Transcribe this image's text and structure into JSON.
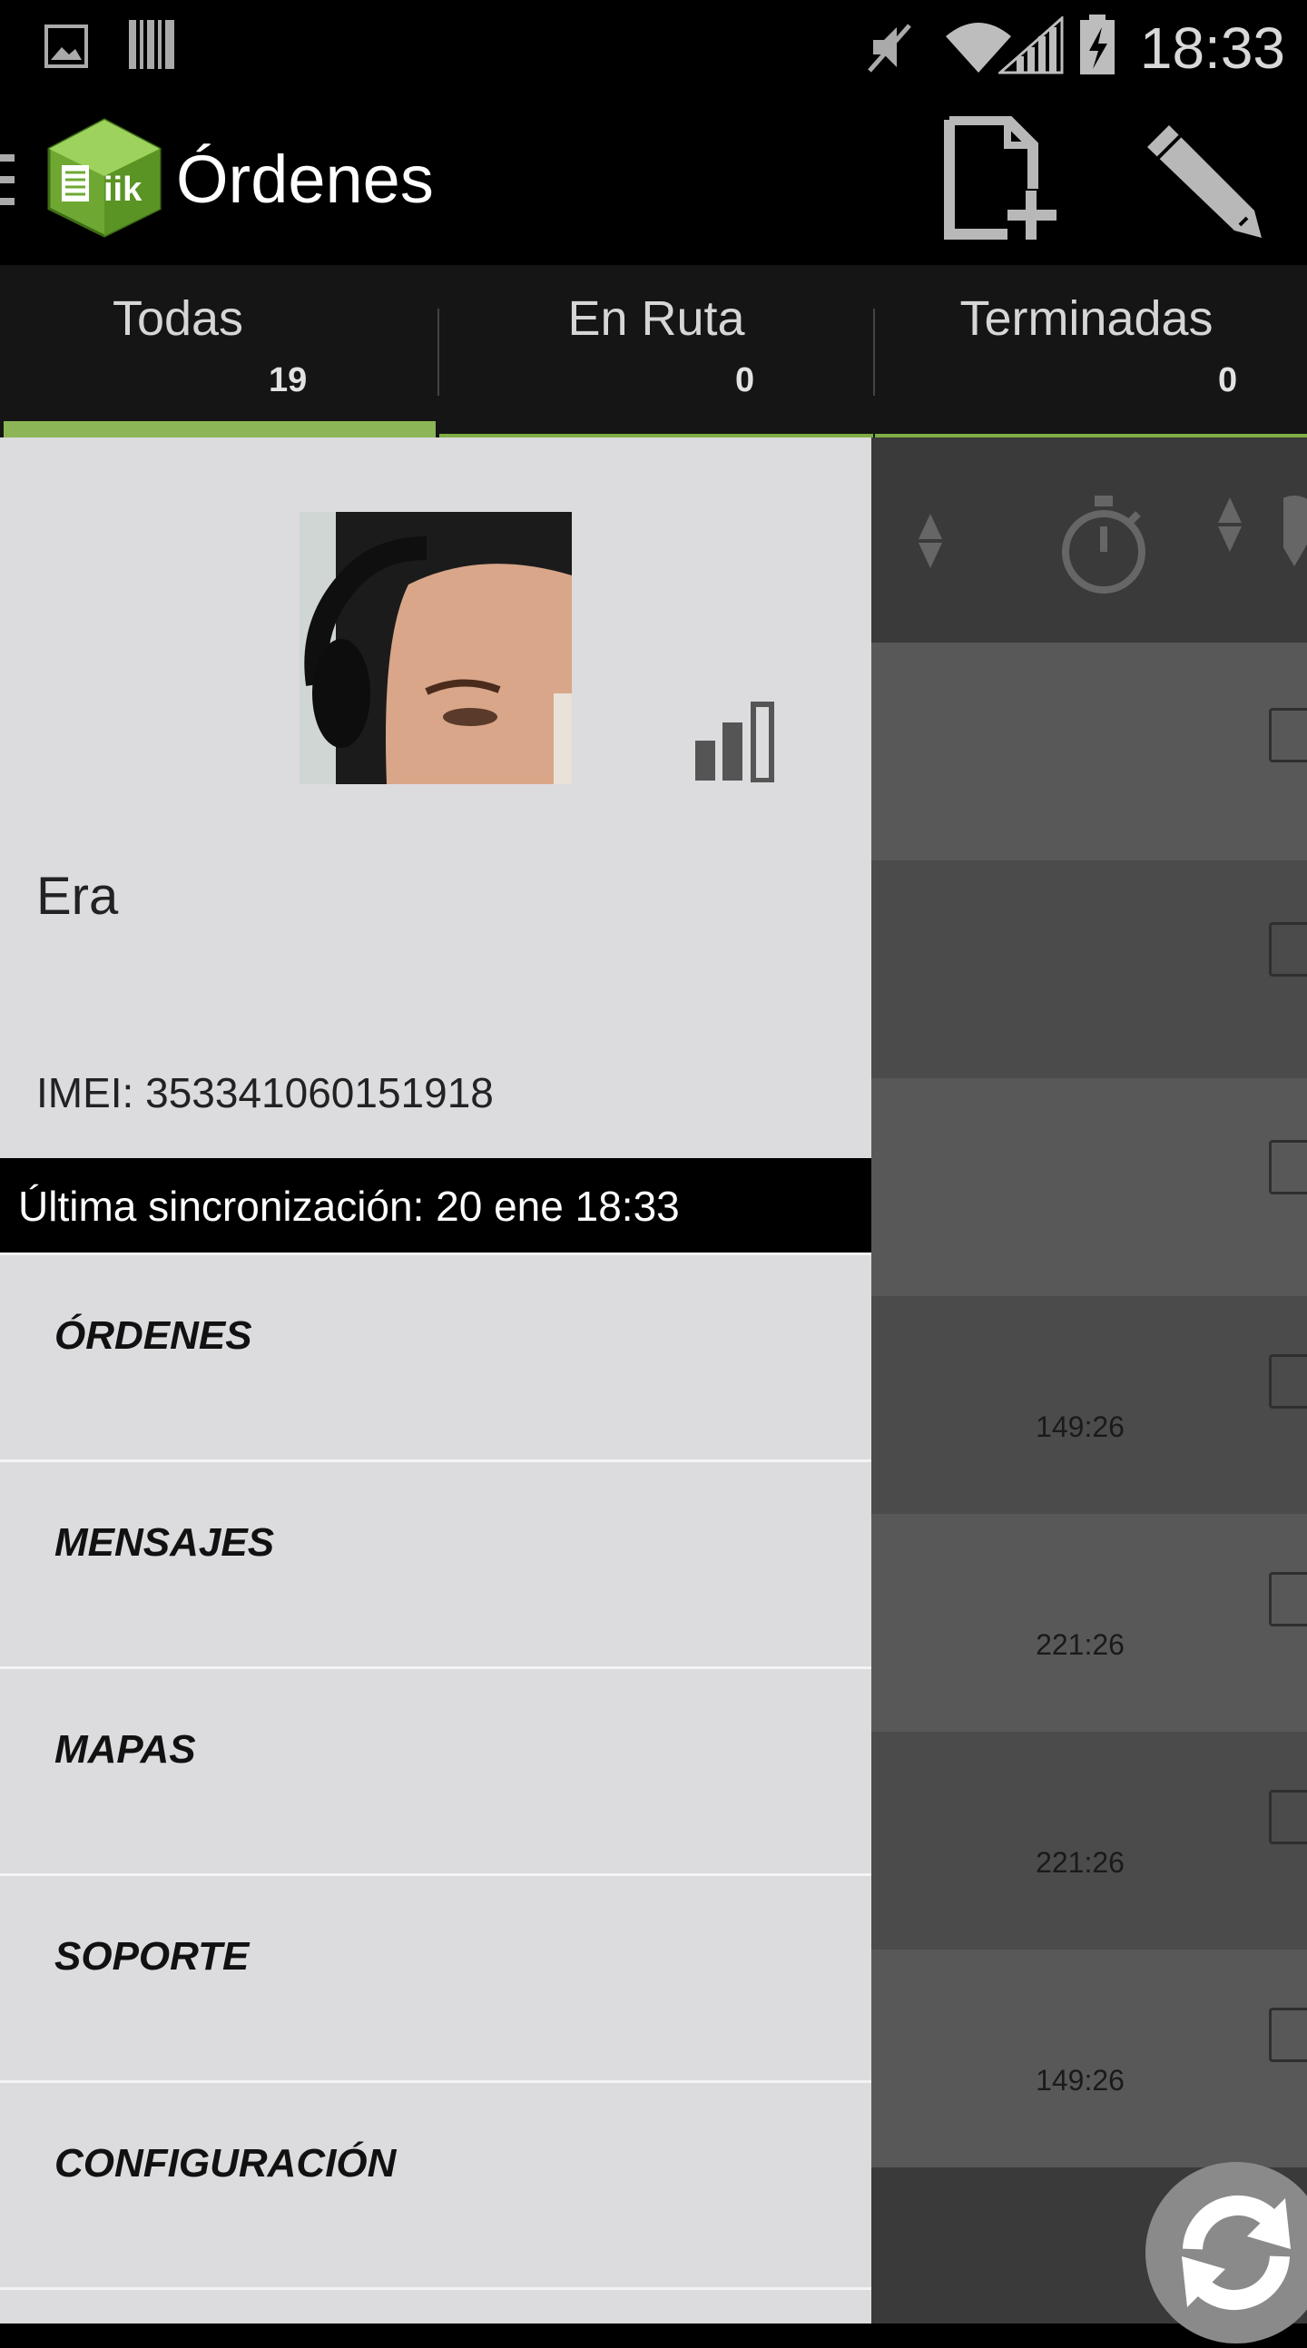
{
  "status_bar": {
    "time": "18:33",
    "icons": [
      "image-icon",
      "barcode-icon",
      "mute-icon",
      "wifi-icon",
      "signal-icon",
      "battery-charging-icon"
    ]
  },
  "action_bar": {
    "title": "Órdenes",
    "logo_text": "iik",
    "actions": [
      "new-document-icon",
      "edit-pencil-icon"
    ]
  },
  "tabs": [
    {
      "label": "Todas",
      "count": "19",
      "active": true
    },
    {
      "label": "En Ruta",
      "count": "0",
      "active": false
    },
    {
      "label": "Terminadas",
      "count": "0",
      "active": false
    }
  ],
  "drawer": {
    "user_name": "Era",
    "imei": "IMEI: 353341060151918",
    "sync_text": "Última sincronización: 20 ene 18:33",
    "menu": [
      {
        "label": "ÓRDENES"
      },
      {
        "label": "MENSAJES"
      },
      {
        "label": "MAPAS"
      },
      {
        "label": "SOPORTE"
      },
      {
        "label": "CONFIGURACIÓN"
      }
    ]
  },
  "background_list": {
    "header_icons": [
      "sort-icon",
      "timer-icon",
      "sort-icon",
      "location-pin-icon"
    ],
    "rows": [
      {
        "time": ""
      },
      {
        "time": ""
      },
      {
        "time": ""
      },
      {
        "time": "149:26"
      },
      {
        "time": "221:26"
      },
      {
        "time": "221:26"
      },
      {
        "time": "149:26"
      }
    ]
  },
  "colors": {
    "accent": "#8bb557",
    "drawer_bg": "#dcdbde",
    "tab_bg": "#151515"
  }
}
